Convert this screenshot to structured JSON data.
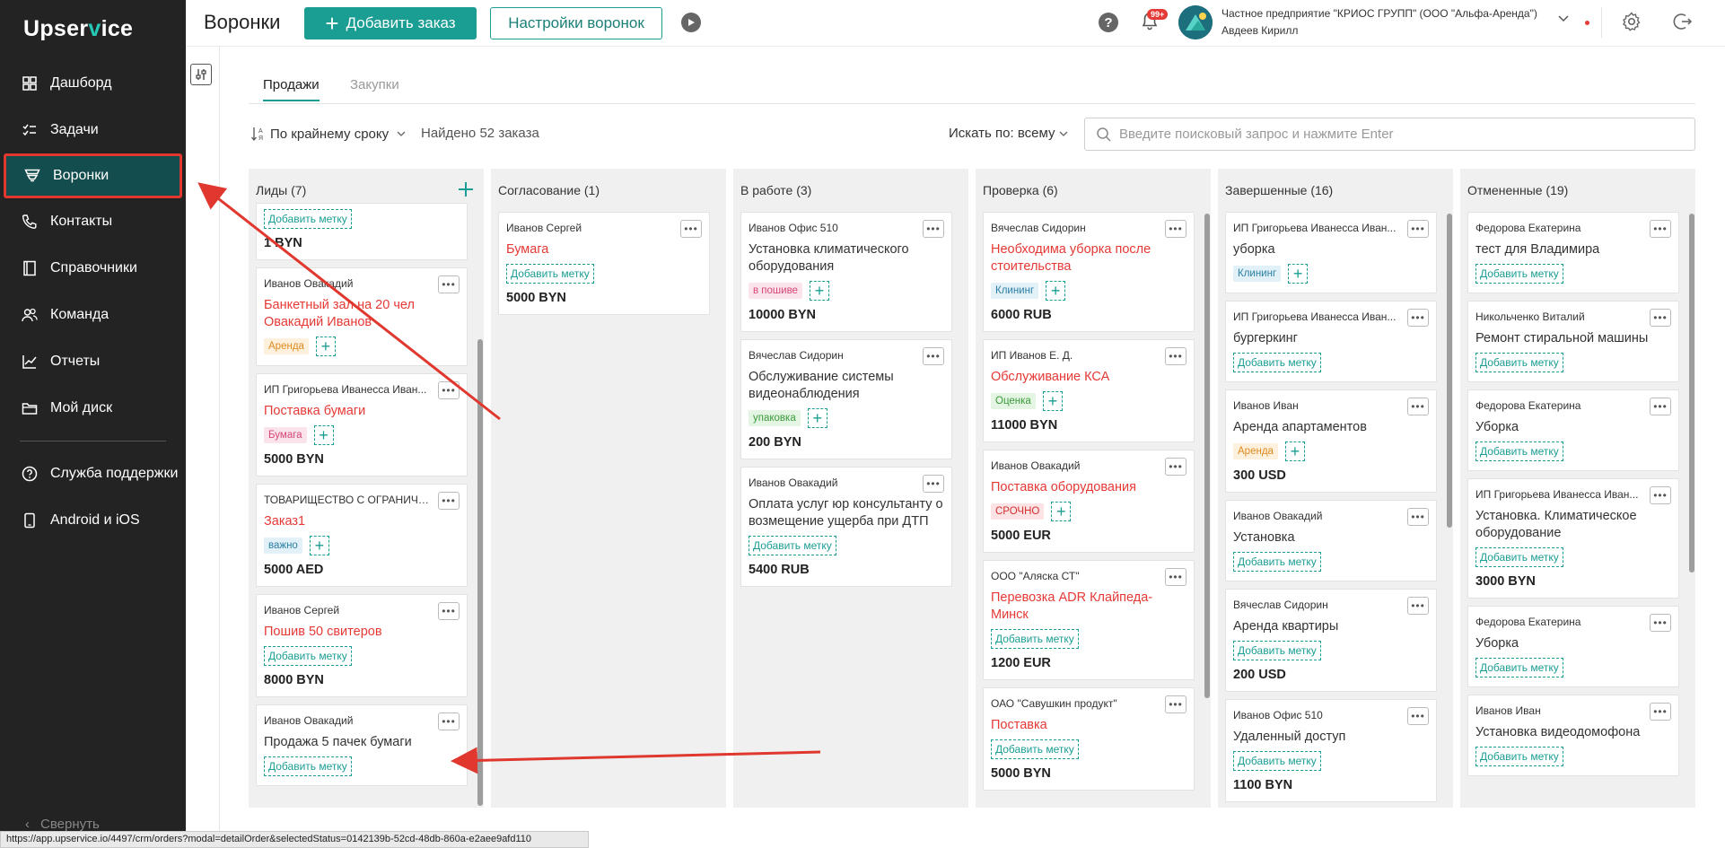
{
  "app": {
    "logo_main": "Upser",
    "logo_accent": "v",
    "logo_end": "ice"
  },
  "sidebar": {
    "items": [
      {
        "label": "Дашборд",
        "icon": "grid-icon"
      },
      {
        "label": "Задачи",
        "icon": "tasks-icon"
      },
      {
        "label": "Воронки",
        "icon": "funnel-icon",
        "active": true
      },
      {
        "label": "Контакты",
        "icon": "phone-icon"
      },
      {
        "label": "Справочники",
        "icon": "book-icon"
      },
      {
        "label": "Команда",
        "icon": "team-icon"
      },
      {
        "label": "Отчеты",
        "icon": "chart-icon"
      },
      {
        "label": "Мой диск",
        "icon": "folder-icon"
      }
    ],
    "bottom_items": [
      {
        "label": "Служба поддержки",
        "icon": "help-circle-icon"
      },
      {
        "label": "Android и iOS",
        "icon": "mobile-icon"
      }
    ],
    "collapse_label": "Свернуть"
  },
  "header": {
    "title": "Воронки",
    "add_order_label": "Добавить заказ",
    "funnel_settings_label": "Настройки воронок",
    "help_label": "?",
    "notifications_badge": "99+",
    "company_line1": "Частное предприятие \"КРИОС ГРУПП\" (ООО \"Альфа-Аренда\")",
    "company_line2": "Авдеев Кирилл"
  },
  "tabs": [
    {
      "label": "Продажи",
      "active": true
    },
    {
      "label": "Закупки",
      "active": false
    }
  ],
  "toolbar": {
    "sort_label": "По крайнему сроку",
    "found_prefix": "Найдено",
    "found_count": "52",
    "found_suffix": "заказа",
    "search_by_label": "Искать по: всему",
    "search_placeholder": "Введите поисковый запрос и нажмите Enter"
  },
  "colors": {
    "accent": "#1a9d93",
    "sidebar_bg": "#232323",
    "active_item_bg": "#144d4e",
    "danger": "#e53935"
  },
  "columns": [
    {
      "title": "Лиды (7)",
      "cards": [
        {
          "partial": true,
          "add_label": "Добавить метку",
          "amount": "1 BYN"
        },
        {
          "client": "Иванов Овакадий",
          "title": "Банкетный зал на 20 чел Овакадий Иванов",
          "red": true,
          "tag": "Аренда",
          "tag_style": "orange",
          "amount": ""
        },
        {
          "client": "ИП Григорьева Иванесса Иван...",
          "title": "Поставка бумаги",
          "red": true,
          "tag": "Бумага",
          "tag_style": "pink",
          "amount": "5000 BYN"
        },
        {
          "client": "ТОВАРИЩЕСТВО С ОГРАНИЧЕ...",
          "title": "Заказ1",
          "red": true,
          "tag": "важно",
          "tag_style": "blue",
          "amount": "5000 AED"
        },
        {
          "client": "Иванов Сергей",
          "title": "Пошив 50 свитеров",
          "red": true,
          "add_label": "Добавить метку",
          "amount": "8000 BYN"
        },
        {
          "client": "Иванов Овакадий",
          "title": "Продажа 5 пачек бумаги",
          "red": false,
          "add_label": "Добавить метку",
          "amount": ""
        }
      ]
    },
    {
      "title": "Согласование (1)",
      "cards": [
        {
          "client": "Иванов Сергей",
          "title": "Бумага",
          "red": true,
          "add_label": "Добавить метку",
          "amount": "5000 BYN"
        }
      ]
    },
    {
      "title": "В работе (3)",
      "cards": [
        {
          "client": "Иванов Офис 510",
          "title": "Установка климатического оборудования",
          "red": false,
          "tag": "в пошиве",
          "tag_style": "pink",
          "amount": "10000 BYN"
        },
        {
          "client": "Вячеслав Сидорин",
          "title": "Обслуживание системы видеонаблюдения",
          "red": false,
          "tag": "упаковка",
          "tag_style": "green",
          "amount": "200 BYN"
        },
        {
          "client": "Иванов Овакадий",
          "title": "Оплата услуг юр консультанту о возмещение ущерба при ДТП",
          "red": false,
          "add_label": "Добавить метку",
          "amount": "5400 RUB"
        }
      ]
    },
    {
      "title": "Проверка (6)",
      "cards": [
        {
          "client": "Вячеслав Сидорин",
          "title": "Необходима уборка после стоительства",
          "red": true,
          "tag": "Клининг",
          "tag_style": "blue",
          "amount": "6000 RUB"
        },
        {
          "client": "ИП Иванов Е. Д.",
          "title": "Обслуживание КСА",
          "red": true,
          "tag": "Оценка",
          "tag_style": "green",
          "amount": "11000 BYN"
        },
        {
          "client": "Иванов Овакадий",
          "title": "Поставка оборудования",
          "red": true,
          "tag": "СРОЧНО",
          "tag_style": "red",
          "amount": "5000 EUR"
        },
        {
          "client": "ООО \"Аляска СТ\"",
          "title": "Перевозка ADR Клайпеда-Минск",
          "red": true,
          "add_label": "Добавить метку",
          "amount": "1200 EUR"
        },
        {
          "client": "ОАО \"Савушкин продукт\"",
          "title": "Поставка",
          "red": true,
          "add_label": "Добавить метку",
          "amount": "5000 BYN"
        }
      ]
    },
    {
      "title": "Завершенные (16)",
      "cards": [
        {
          "client": "ИП Григорьева Иванесса Иван...",
          "title": "уборка",
          "red": false,
          "tag": "Клининг",
          "tag_style": "blue",
          "amount": ""
        },
        {
          "client": "ИП Григорьева Иванесса Иван...",
          "title": "бургеркинг",
          "red": false,
          "add_label": "Добавить метку",
          "amount": ""
        },
        {
          "client": "Иванов Иван",
          "title": "Аренда апартаментов",
          "red": false,
          "tag": "Аренда",
          "tag_style": "orange",
          "amount": "300 USD"
        },
        {
          "client": "Иванов Овакадий",
          "title": "Установка",
          "red": false,
          "add_label": "Добавить метку",
          "amount": ""
        },
        {
          "client": "Вячеслав Сидорин",
          "title": "Аренда квартиры",
          "red": false,
          "add_label": "Добавить метку",
          "amount": "200 USD"
        },
        {
          "client": "Иванов Офис 510",
          "title": "Удаленный доступ",
          "red": false,
          "add_label": "Добавить метку",
          "amount": "1100 BYN"
        }
      ]
    },
    {
      "title": "Отмененные (19)",
      "cards": [
        {
          "client": "Федорова Екатерина",
          "title": "тест для Владимира",
          "red": false,
          "add_label": "Добавить метку",
          "amount": ""
        },
        {
          "client": "Никольченко Виталий",
          "title": "Ремонт стиральной машины",
          "red": false,
          "add_label": "Добавить метку",
          "amount": ""
        },
        {
          "client": "Федорова Екатерина",
          "title": "Уборка",
          "red": false,
          "add_label": "Добавить метку",
          "amount": ""
        },
        {
          "client": "ИП Григорьева Иванесса Иван...",
          "title": "Установка. Климатическое оборудование",
          "red": false,
          "add_label": "Добавить метку",
          "amount": "3000 BYN"
        },
        {
          "client": "Федорова Екатерина",
          "title": "Уборка",
          "red": false,
          "add_label": "Добавить метку",
          "amount": ""
        },
        {
          "client": "Иванов Иван",
          "title": "Установка видеодомофона",
          "red": false,
          "add_label": "Добавить метку",
          "amount": ""
        }
      ]
    }
  ],
  "status_url": "https://app.upservice.io/4497/crm/orders?modal=detailOrder&selectedStatus=0142139b-52cd-48db-860a-e2aee9afd110"
}
